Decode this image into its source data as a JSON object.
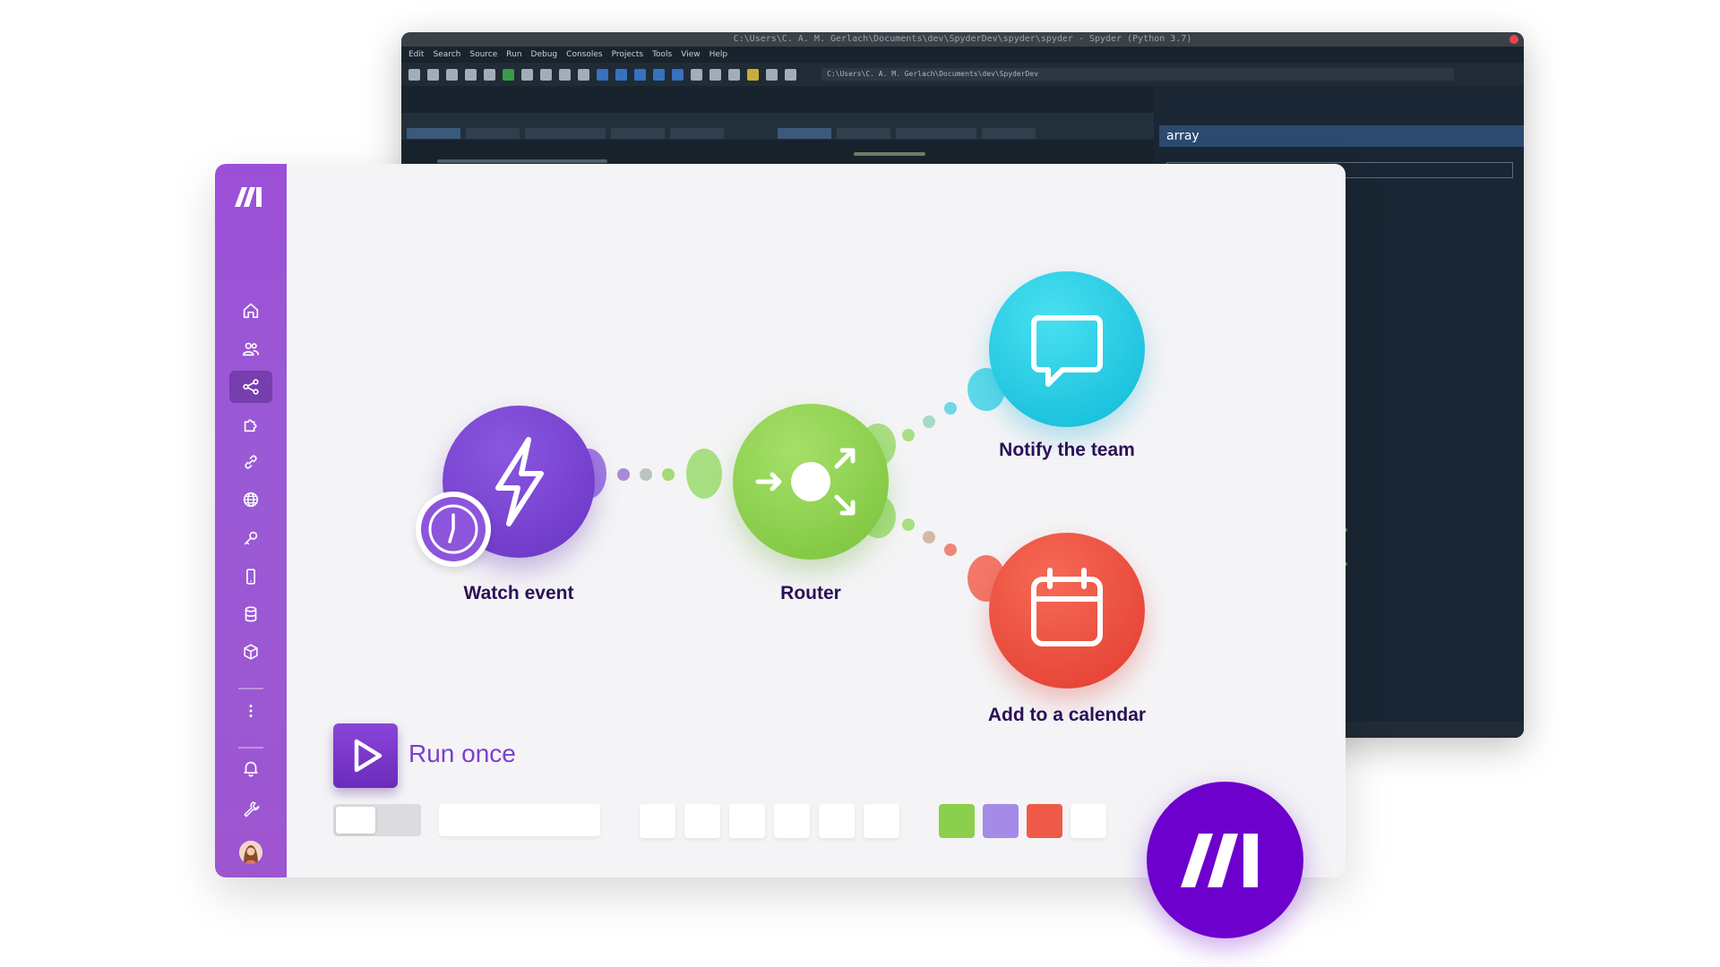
{
  "ide": {
    "title": "C:\\Users\\C. A. M. Gerlach\\Documents\\dev\\SpyderDev\\spyder\\spyder - Spyder (Python 3.7)",
    "menu": [
      "Edit",
      "Search",
      "Source",
      "Run",
      "Debug",
      "Consoles",
      "Projects",
      "Tools",
      "View",
      "Help"
    ],
    "path": "C:\\Users\\C. A. M. Gerlach\\Documents\\dev\\SpyderDev",
    "help_title": "array"
  },
  "sidebar": {
    "items": [
      {
        "icon": "home-icon"
      },
      {
        "icon": "team-icon"
      },
      {
        "icon": "share-icon",
        "active": true
      },
      {
        "icon": "puzzle-icon"
      },
      {
        "icon": "link-icon"
      },
      {
        "icon": "globe-icon"
      },
      {
        "icon": "key-icon"
      },
      {
        "icon": "mobile-icon"
      },
      {
        "icon": "database-icon"
      },
      {
        "icon": "cube-icon"
      },
      {
        "icon": "more-icon"
      },
      {
        "icon": "bell-icon"
      },
      {
        "icon": "wrench-icon"
      }
    ]
  },
  "scenario": {
    "nodes": [
      {
        "id": "watch",
        "label": "Watch event",
        "color": "#7a3fd0"
      },
      {
        "id": "router",
        "label": "Router",
        "color": "#8ccf4d"
      },
      {
        "id": "notify",
        "label": "Notify the team",
        "color": "#1ec8e0"
      },
      {
        "id": "calendar",
        "label": "Add to a calendar",
        "color": "#ef4d3d"
      }
    ],
    "run_label": "Run once",
    "swatches": [
      "#8ccf4d",
      "#a58be8",
      "#ef5a48"
    ]
  }
}
